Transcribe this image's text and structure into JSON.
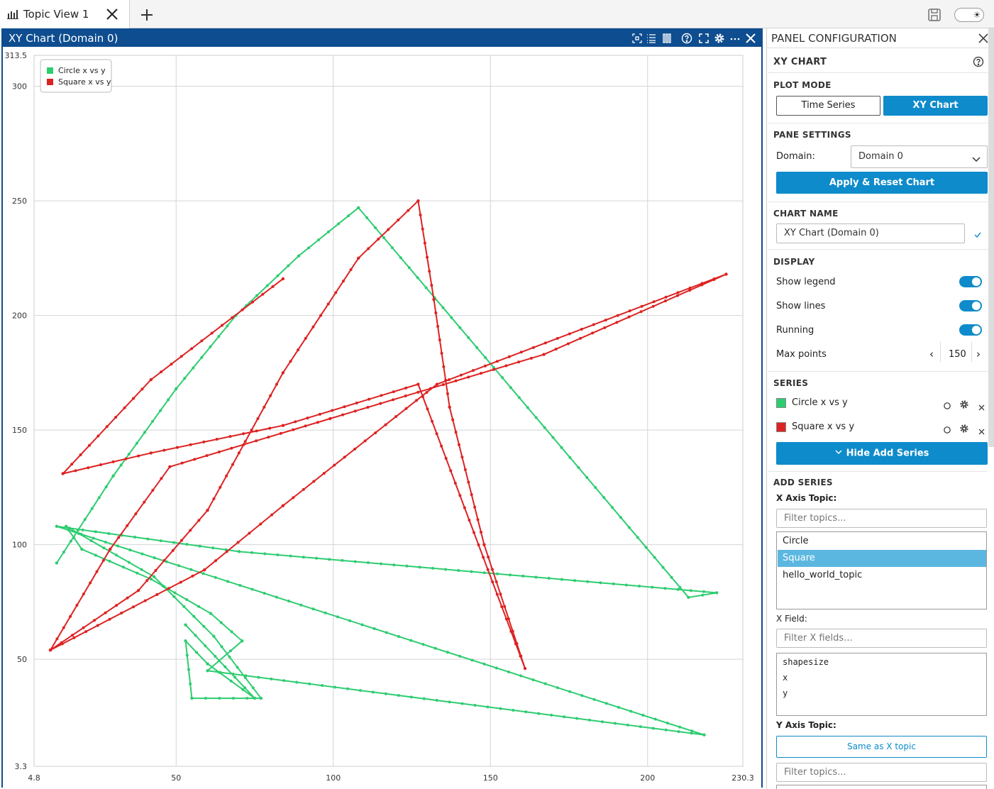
{
  "tabbar": {
    "tab_label": "Topic View 1",
    "new_tab_symbol": "+"
  },
  "chart_panel": {
    "title": "XY Chart (Domain 0)"
  },
  "chart_data": {
    "type": "scatter",
    "title": "",
    "xlim": [
      4.8,
      230.3
    ],
    "ylim": [
      3.3,
      313.5
    ],
    "x_ticks": [
      "4.8",
      "50",
      "100",
      "150",
      "200",
      "230.3"
    ],
    "x_tick_values": [
      4.8,
      50,
      100,
      150,
      200,
      230.3
    ],
    "y_ticks": [
      "313.5",
      "300",
      "250",
      "200",
      "150",
      "100",
      "50",
      "3.3"
    ],
    "y_tick_values": [
      313.5,
      300,
      250,
      200,
      150,
      100,
      50,
      3.3
    ],
    "grid": true,
    "legend_position": "top-left",
    "series": [
      {
        "name": "Circle x vs y",
        "color": "#2ecc71",
        "x": [
          53,
          75,
          60,
          53,
          55,
          77,
          62,
          43,
          15,
          20,
          42,
          61,
          71,
          60,
          218,
          12,
          70,
          222,
          213,
          108,
          89,
          69,
          50,
          30,
          12
        ],
        "y": [
          65,
          33,
          48,
          58,
          33,
          33,
          60,
          86,
          108,
          98,
          85,
          70,
          58,
          45,
          17,
          108,
          97,
          79,
          77,
          247,
          226,
          200,
          168,
          130,
          92
        ]
      },
      {
        "name": "Square x vs y",
        "color": "#dd2222",
        "x": [
          84,
          42,
          14,
          42,
          84,
          127,
          161,
          148,
          137,
          132,
          127,
          108,
          84,
          60,
          38,
          10,
          59,
          84,
          133,
          225,
          167,
          99,
          48,
          29,
          10
        ],
        "y": [
          216,
          172,
          131,
          140,
          152,
          170,
          46,
          100,
          160,
          207,
          250,
          225,
          175,
          115,
          80,
          54,
          89,
          117,
          170,
          218,
          183,
          155,
          134,
          98,
          54
        ]
      }
    ]
  },
  "config": {
    "title": "PANEL CONFIGURATION",
    "xy_chart_heading": "XY CHART",
    "plot_mode": {
      "heading": "PLOT MODE",
      "time_series": "Time Series",
      "xy_chart": "XY Chart"
    },
    "pane_settings": {
      "heading": "PANE SETTINGS",
      "domain_label": "Domain:",
      "domain_value": "Domain 0",
      "apply_button": "Apply & Reset Chart"
    },
    "chart_name": {
      "heading": "CHART NAME",
      "value": "XY Chart (Domain 0)"
    },
    "display": {
      "heading": "DISPLAY",
      "show_legend": "Show legend",
      "show_lines": "Show lines",
      "running": "Running",
      "max_points_label": "Max points",
      "max_points_value": "150"
    },
    "series": {
      "heading": "SERIES",
      "items": [
        {
          "label": "Circle x vs y",
          "color": "#2ecc71"
        },
        {
          "label": "Square x vs y",
          "color": "#dd2222"
        }
      ],
      "hide_add_series": "Hide Add Series"
    },
    "add_series": {
      "heading": "ADD SERIES",
      "x_axis_topic_label": "X Axis Topic:",
      "filter_topics_placeholder": "Filter topics...",
      "topics": [
        "Circle",
        "Square",
        "hello_world_topic"
      ],
      "selected_topic": "Square",
      "x_field_label": "X Field:",
      "filter_x_fields_placeholder": "Filter X fields...",
      "fields": [
        "shapesize",
        "x",
        "y"
      ],
      "y_axis_topic_label": "Y Axis Topic:",
      "same_as_x_button": "Same as X topic",
      "filter_topics_placeholder_2": "Filter topics..."
    }
  }
}
